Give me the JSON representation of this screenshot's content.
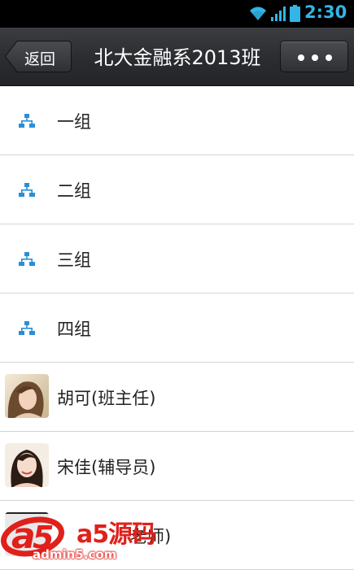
{
  "status_bar": {
    "time": "2:30",
    "icons": [
      "wifi-icon",
      "signal-icon",
      "battery-icon"
    ],
    "accent_color": "#33b5e5"
  },
  "header": {
    "back_label": "返回",
    "title": "北大金融系2013班",
    "more_icon": "more-dots-icon"
  },
  "groups": [
    {
      "label": "一组",
      "icon": "group-tree-icon"
    },
    {
      "label": "二组",
      "icon": "group-tree-icon"
    },
    {
      "label": "三组",
      "icon": "group-tree-icon"
    },
    {
      "label": "四组",
      "icon": "group-tree-icon"
    }
  ],
  "members": [
    {
      "label": "胡可(班主任)",
      "icon": "avatar"
    },
    {
      "label": "宋佳(辅导员)",
      "icon": "avatar"
    },
    {
      "label": "老师)",
      "icon": "avatar"
    }
  ],
  "watermark": {
    "brand": "a5源码",
    "domain": "admin5.com"
  }
}
